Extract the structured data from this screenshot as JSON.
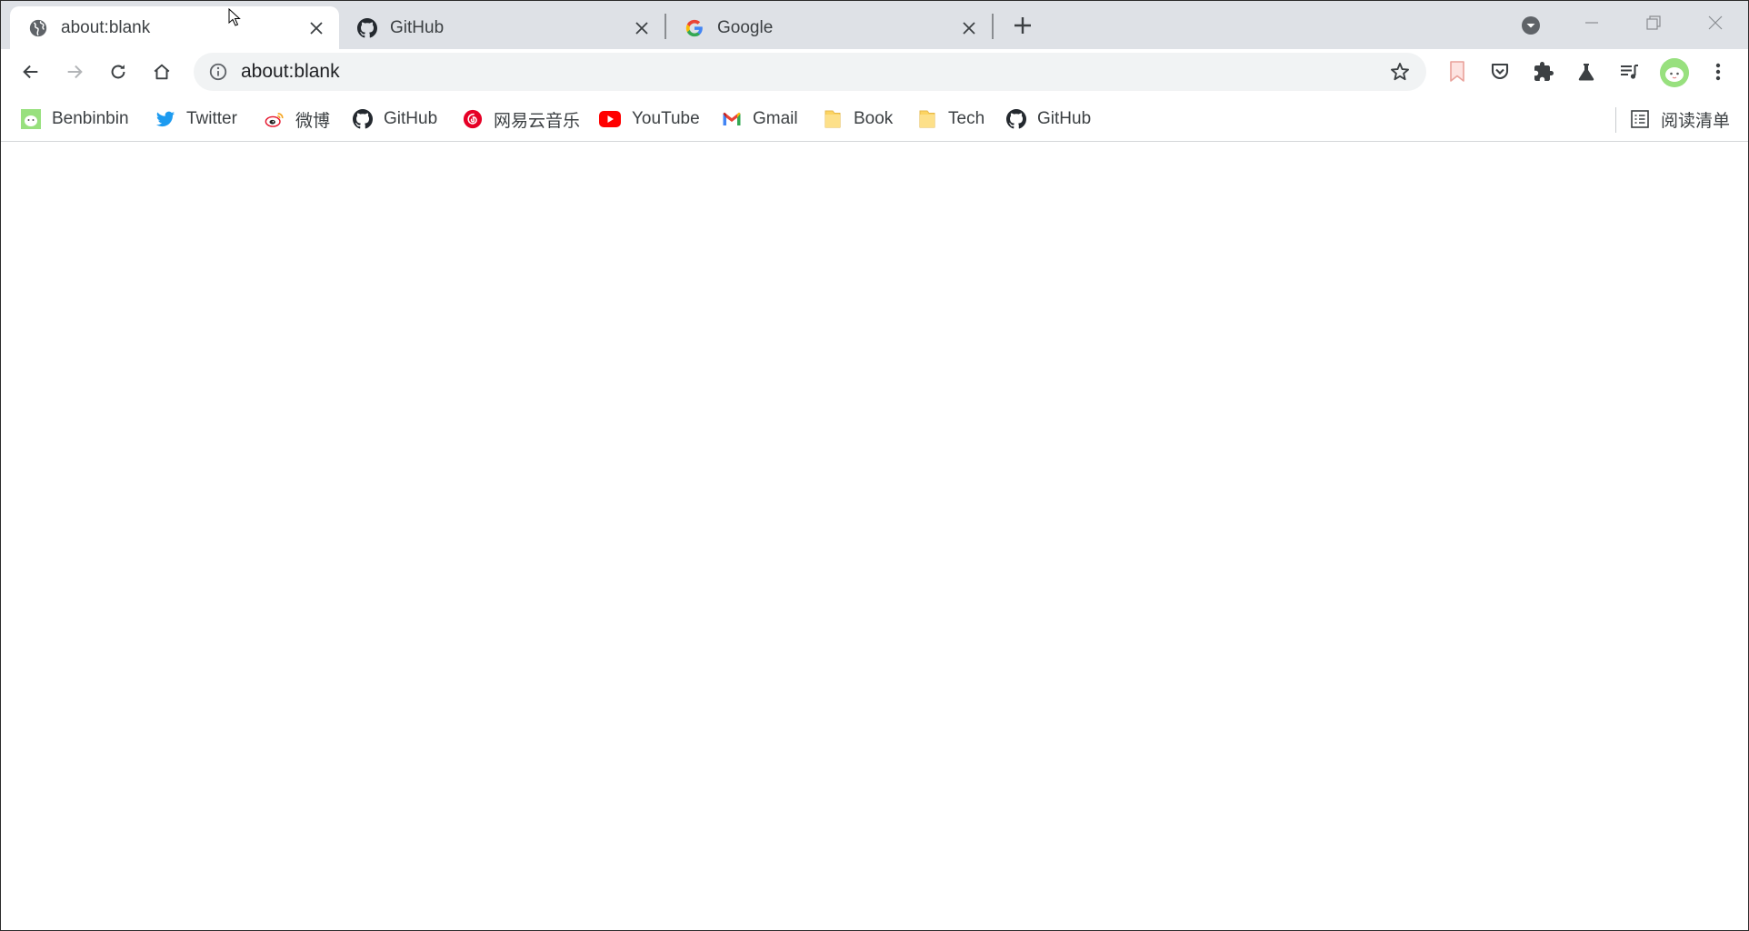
{
  "tabs": [
    {
      "title": "about:blank",
      "active": true,
      "icon": "globe-icon"
    },
    {
      "title": "GitHub",
      "active": false,
      "icon": "github-icon"
    },
    {
      "title": "Google",
      "active": false,
      "icon": "google-icon"
    }
  ],
  "omnibox": {
    "url": "about:blank"
  },
  "bookmarks": [
    {
      "label": "Benbinbin",
      "icon": "avatar-icon"
    },
    {
      "label": "Twitter",
      "icon": "twitter-icon"
    },
    {
      "label": "微博",
      "icon": "weibo-icon"
    },
    {
      "label": "GitHub",
      "icon": "github-icon"
    },
    {
      "label": "网易云音乐",
      "icon": "netease-music-icon"
    },
    {
      "label": "YouTube",
      "icon": "youtube-icon"
    },
    {
      "label": "Gmail",
      "icon": "gmail-icon"
    },
    {
      "label": "Book",
      "icon": "folder-icon"
    },
    {
      "label": "Tech",
      "icon": "folder-icon"
    },
    {
      "label": "GitHub",
      "icon": "github-icon"
    }
  ],
  "reading_list": {
    "label": "阅读清单"
  },
  "colors": {
    "tabstrip_bg": "#dee1e6",
    "omnibox_bg": "#f1f3f4",
    "twitter": "#1d9bf0",
    "youtube": "#ff0000",
    "netease": "#e60026",
    "folder": "#fcd462"
  }
}
